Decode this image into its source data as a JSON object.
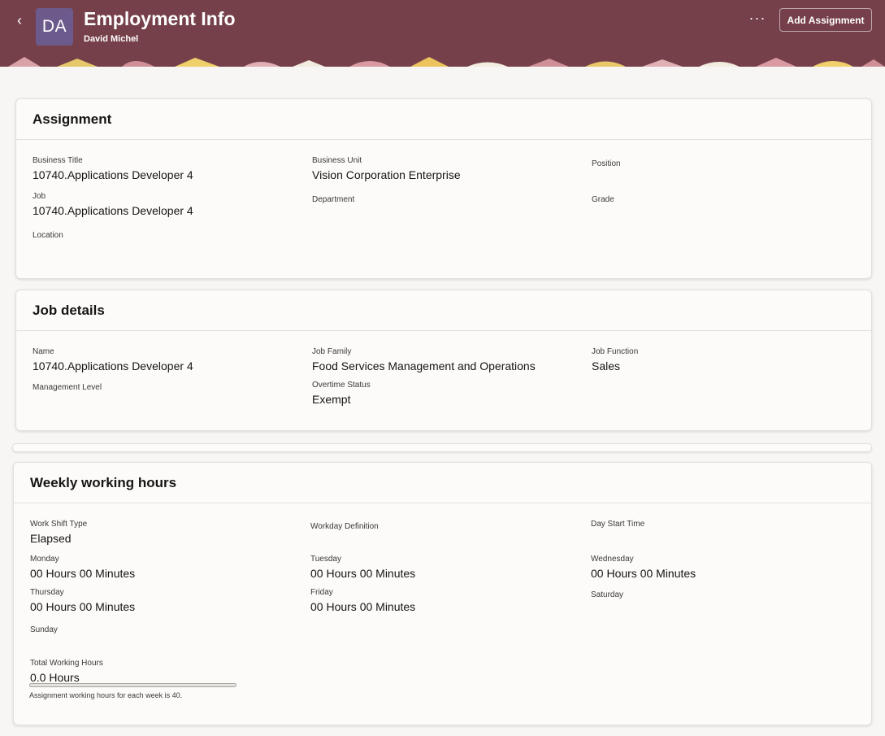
{
  "header": {
    "back_icon": "chevron-left-icon",
    "avatar_initials": "DA",
    "title": "Employment Info",
    "subtitle": "David Michel",
    "more_icon": "more-horizontal-icon",
    "add_assignment_label": "Add Assignment",
    "colors": {
      "banner": "#75404a",
      "avatar": "#6d5a8c"
    }
  },
  "assignment": {
    "title": "Assignment",
    "business_title": {
      "label": "Business Title",
      "value": "10740.Applications Developer 4"
    },
    "business_unit": {
      "label": "Business Unit",
      "value": "Vision Corporation Enterprise"
    },
    "position": {
      "label": "Position",
      "value": ""
    },
    "job": {
      "label": "Job",
      "value": "10740.Applications Developer 4"
    },
    "department": {
      "label": "Department",
      "value": ""
    },
    "grade": {
      "label": "Grade",
      "value": ""
    },
    "location": {
      "label": "Location",
      "value": ""
    }
  },
  "job_details": {
    "title": "Job details",
    "name": {
      "label": "Name",
      "value": "10740.Applications Developer 4"
    },
    "job_family": {
      "label": "Job Family",
      "value": "Food Services Management and Operations"
    },
    "job_function": {
      "label": "Job Function",
      "value": "Sales"
    },
    "management_level": {
      "label": "Management Level",
      "value": ""
    },
    "overtime_status": {
      "label": "Overtime Status",
      "value": "Exempt"
    }
  },
  "weekly": {
    "title": "Weekly working hours",
    "work_shift_type": {
      "label": "Work Shift Type",
      "value": "Elapsed"
    },
    "workday_definition": {
      "label": "Workday Definition",
      "value": ""
    },
    "day_start_time": {
      "label": "Day Start Time",
      "value": ""
    },
    "monday": {
      "label": "Monday",
      "value": "00 Hours 00 Minutes"
    },
    "tuesday": {
      "label": "Tuesday",
      "value": "00 Hours 00 Minutes"
    },
    "wednesday": {
      "label": "Wednesday",
      "value": "00 Hours 00 Minutes"
    },
    "thursday": {
      "label": "Thursday",
      "value": "00 Hours 00 Minutes"
    },
    "friday": {
      "label": "Friday",
      "value": "00 Hours 00 Minutes"
    },
    "saturday": {
      "label": "Saturday",
      "value": ""
    },
    "sunday": {
      "label": "Sunday",
      "value": ""
    },
    "total": {
      "label": "Total Working Hours",
      "value": "0.0 Hours",
      "progress_fraction": 0.0
    },
    "note": "Assignment working hours for each week is 40."
  }
}
